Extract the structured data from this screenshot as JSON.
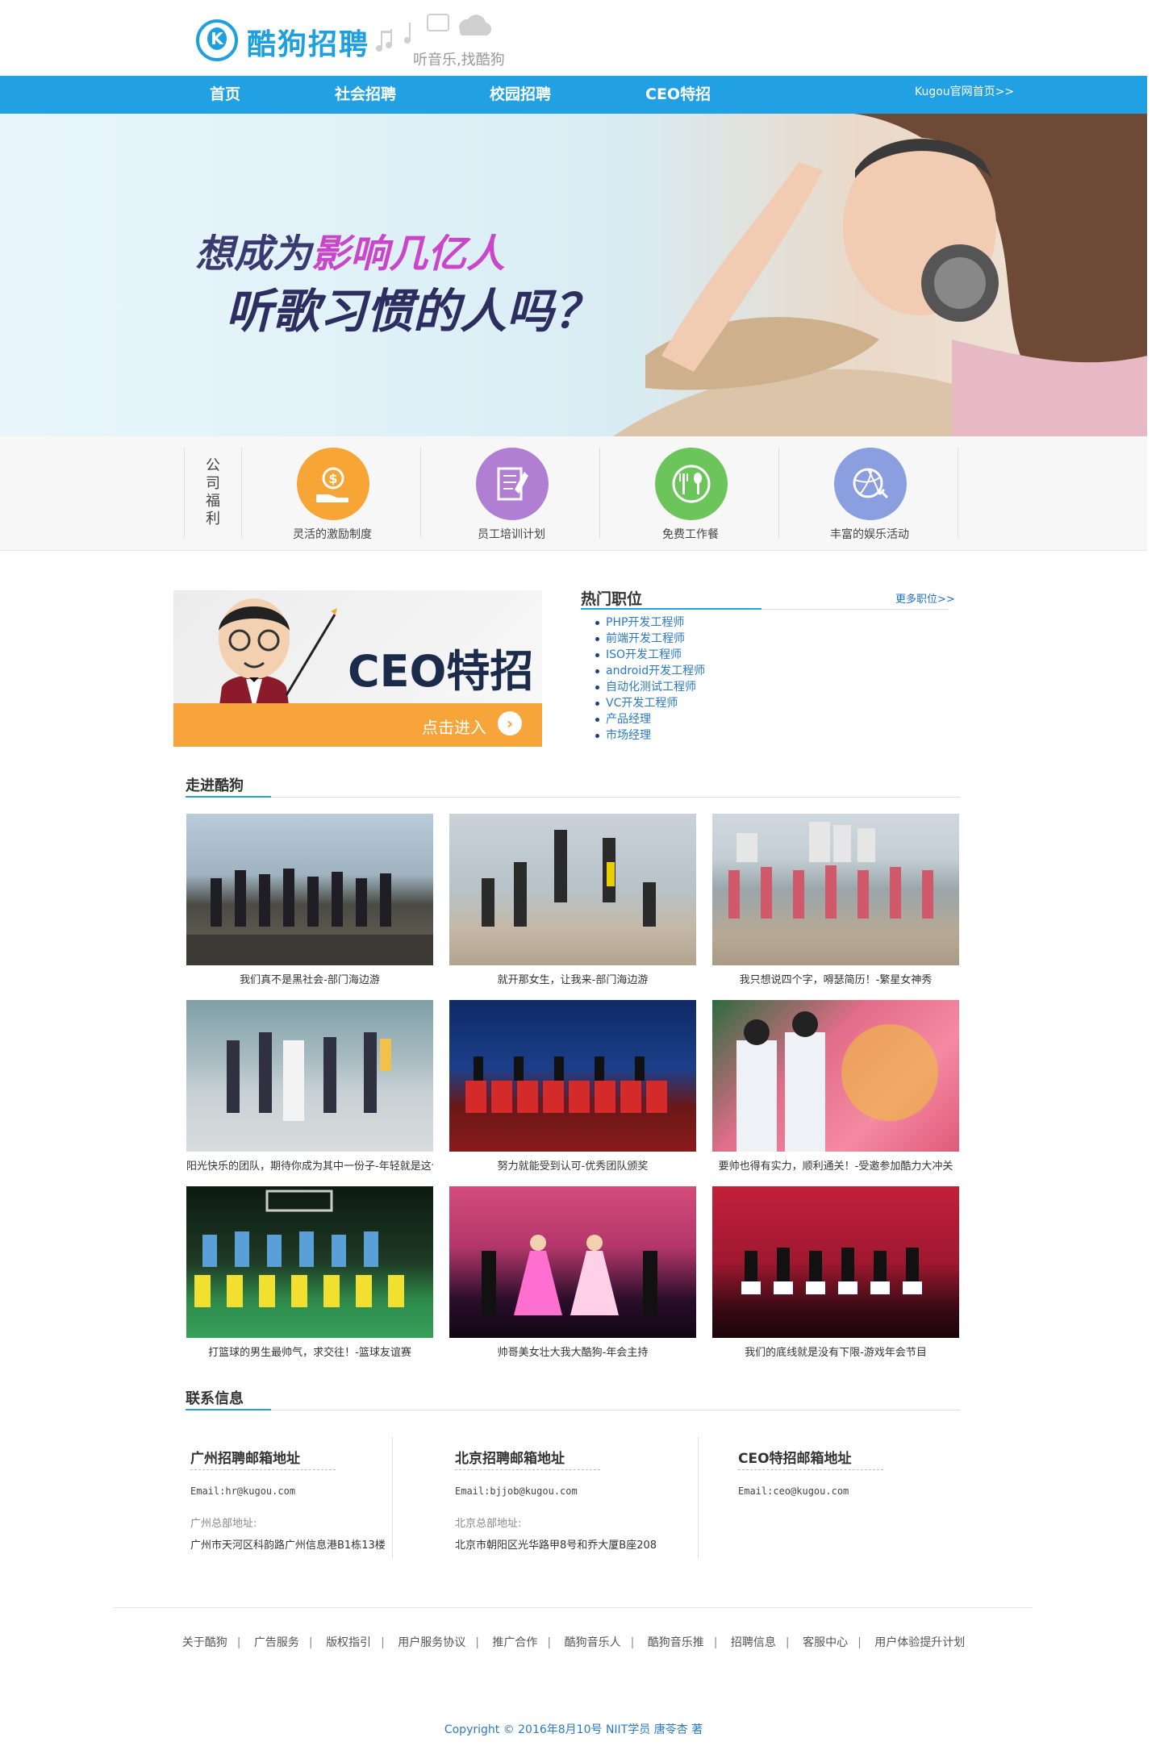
{
  "header": {
    "logo_letter": "K",
    "logo_title": "酷狗招聘",
    "slogan": "听音乐,找酷狗"
  },
  "nav": {
    "items": [
      "首页",
      "社会招聘",
      "校园招聘",
      "CEO特招"
    ],
    "home_link": "Kugou官网首页>>"
  },
  "banner": {
    "line1_prefix": "想成为",
    "line1_highlight": "影响几亿人",
    "line2": "听歌习惯的人吗？"
  },
  "benefits": {
    "label": "公司福利",
    "items": [
      {
        "label": "灵活的激励制度",
        "icon": "money-hand-icon",
        "color": "#f7a534"
      },
      {
        "label": "员工培训计划",
        "icon": "document-pen-icon",
        "color": "#b07ed3"
      },
      {
        "label": "免费工作餐",
        "icon": "fork-spoon-icon",
        "color": "#6cc55a"
      },
      {
        "label": "丰富的娱乐活动",
        "icon": "sports-ball-icon",
        "color": "#8a9ee0"
      }
    ]
  },
  "ceo_card": {
    "title": "CEO特招",
    "enter": "点击进入",
    "arrow": "›"
  },
  "hot_jobs": {
    "title": "热门职位",
    "more": "更多职位>>",
    "items": [
      "PHP开发工程师",
      "前端开发工程师",
      "ISO开发工程师",
      "android开发工程师",
      "自动化测试工程师",
      "VC开发工程师",
      "产品经理",
      "市场经理"
    ]
  },
  "about": {
    "title": "走进酷狗",
    "photos": [
      {
        "caption": "我们真不是黑社会-部门海边游"
      },
      {
        "caption": "就开那女生，让我来-部门海边游"
      },
      {
        "caption": "我只想说四个字，嘚瑟简历！-繁星女神秀"
      },
      {
        "caption": "阳光快乐的团队，期待你成为其中一份子-年轻就是这个味"
      },
      {
        "caption": "努力就能受到认可-优秀团队颁奖"
      },
      {
        "caption": "要帅也得有实力，顺利通关！-受邀参加酷力大冲关"
      },
      {
        "caption": "打篮球的男生最帅气，求交往！-篮球友谊赛"
      },
      {
        "caption": "帅哥美女壮大我大酷狗-年会主持"
      },
      {
        "caption": "我们的底线就是没有下限-游戏年会节目"
      }
    ]
  },
  "contact": {
    "title": "联系信息",
    "blocks": [
      {
        "title": "广州招聘邮箱地址",
        "email": "Email:hr@kugou.com",
        "hq_label": "广州总部地址:",
        "address": "广州市天河区科韵路广州信息港B1栋13楼"
      },
      {
        "title": "北京招聘邮箱地址",
        "email": "Email:bjjob@kugou.com",
        "hq_label": "北京总部地址:",
        "address": "北京市朝阳区光华路甲8号和乔大厦B座208"
      },
      {
        "title": "CEO特招邮箱地址",
        "email": "Email:ceo@kugou.com"
      }
    ]
  },
  "footer": {
    "links": [
      "关于酷狗",
      "广告服务",
      "版权指引",
      "用户服务协议",
      "推广合作",
      "酷狗音乐人",
      "酷狗音乐推",
      "招聘信息",
      "客服中心",
      "用户体验提升计划"
    ],
    "separator": "|",
    "copyright_prefix": "Copyright © 2016年8月10号 NIIT学员 ",
    "copyright_name": "唐苓杏",
    "copyright_suffix": " 著"
  }
}
